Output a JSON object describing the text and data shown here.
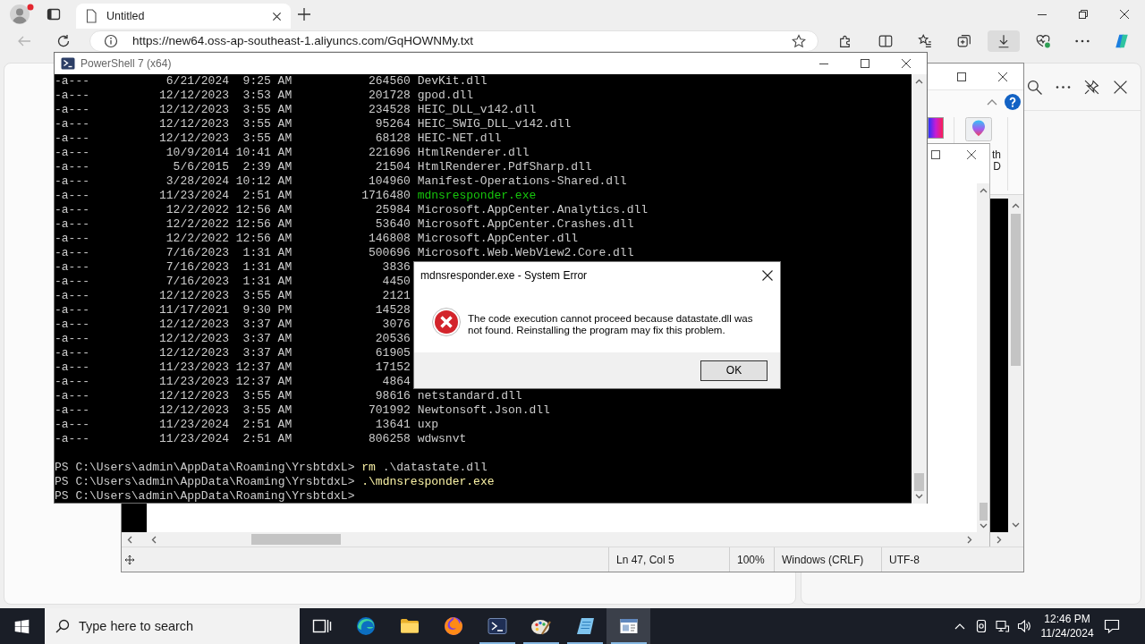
{
  "browser": {
    "tabs": [
      {
        "title": "Untitled",
        "selected": true
      }
    ],
    "back_button": {
      "disabled": true
    },
    "address_bar": {
      "url": "https://new64.oss-ap-southeast-1.aliyuncs.com/GqHOWNMy.txt"
    },
    "toolbar_buttons": [
      {
        "kind": "extensions",
        "selected": false
      },
      {
        "kind": "split",
        "selected": false
      },
      {
        "kind": "favorites",
        "selected": false
      },
      {
        "kind": "collections",
        "selected": false
      },
      {
        "kind": "downloads",
        "selected": true
      },
      {
        "kind": "essentials",
        "selected": false
      },
      {
        "kind": "more",
        "selected": false
      },
      {
        "kind": "copilot",
        "selected": false
      }
    ]
  },
  "background_window": {
    "ribbon_label": [
      "th",
      "D"
    ],
    "status_bar": {
      "position": "Ln 47, Col 5",
      "zoom": "100%",
      "line_ending": "Windows (CRLF)",
      "encoding": "UTF-8"
    }
  },
  "terminal": {
    "title": "PowerShell 7 (x64)",
    "files": [
      {
        "mode": "-a---",
        "date": "6/21/2024",
        "time": "9:25 AM",
        "length": "264560",
        "name": "DevKit.dll",
        "kind": "file"
      },
      {
        "mode": "-a---",
        "date": "12/12/2023",
        "time": "3:53 AM",
        "length": "201728",
        "name": "gpod.dll",
        "kind": "file"
      },
      {
        "mode": "-a---",
        "date": "12/12/2023",
        "time": "3:55 AM",
        "length": "234528",
        "name": "HEIC_DLL_v142.dll",
        "kind": "file"
      },
      {
        "mode": "-a---",
        "date": "12/12/2023",
        "time": "3:55 AM",
        "length": "95264",
        "name": "HEIC_SWIG_DLL_v142.dll",
        "kind": "file"
      },
      {
        "mode": "-a---",
        "date": "12/12/2023",
        "time": "3:55 AM",
        "length": "68128",
        "name": "HEIC-NET.dll",
        "kind": "file"
      },
      {
        "mode": "-a---",
        "date": "10/9/2014",
        "time": "10:41 AM",
        "length": "221696",
        "name": "HtmlRenderer.dll",
        "kind": "file"
      },
      {
        "mode": "-a---",
        "date": "5/6/2015",
        "time": "2:39 AM",
        "length": "21504",
        "name": "HtmlRenderer.PdfSharp.dll",
        "kind": "file"
      },
      {
        "mode": "-a---",
        "date": "3/28/2024",
        "time": "10:12 AM",
        "length": "104960",
        "name": "Manifest-Operations-Shared.dll",
        "kind": "file"
      },
      {
        "mode": "-a---",
        "date": "11/23/2024",
        "time": "2:51 AM",
        "length": "1716480",
        "name": "mdnsresponder.exe",
        "kind": "exe"
      },
      {
        "mode": "-a---",
        "date": "12/2/2022",
        "time": "12:56 AM",
        "length": "25984",
        "name": "Microsoft.AppCenter.Analytics.dll",
        "kind": "file"
      },
      {
        "mode": "-a---",
        "date": "12/2/2022",
        "time": "12:56 AM",
        "length": "53640",
        "name": "Microsoft.AppCenter.Crashes.dll",
        "kind": "file"
      },
      {
        "mode": "-a---",
        "date": "12/2/2022",
        "time": "12:56 AM",
        "length": "146808",
        "name": "Microsoft.AppCenter.dll",
        "kind": "file"
      },
      {
        "mode": "-a---",
        "date": "7/16/2023",
        "time": "1:31 AM",
        "length": "500696",
        "name": "Microsoft.Web.WebView2.Core.dll",
        "kind": "file"
      },
      {
        "mode": "-a---",
        "date": "7/16/2023",
        "time": "1:31 AM",
        "length": "3836"
      },
      {
        "mode": "-a---",
        "date": "7/16/2023",
        "time": "1:31 AM",
        "length": "4450"
      },
      {
        "mode": "-a---",
        "date": "12/12/2023",
        "time": "3:55 AM",
        "length": "2121"
      },
      {
        "mode": "-a---",
        "date": "11/17/2021",
        "time": "9:30 PM",
        "length": "14528"
      },
      {
        "mode": "-a---",
        "date": "12/12/2023",
        "time": "3:37 AM",
        "length": "3076"
      },
      {
        "mode": "-a---",
        "date": "12/12/2023",
        "time": "3:37 AM",
        "length": "20536"
      },
      {
        "mode": "-a---",
        "date": "12/12/2023",
        "time": "3:37 AM",
        "length": "61905"
      },
      {
        "mode": "-a---",
        "date": "11/23/2023",
        "time": "12:37 AM",
        "length": "17152"
      },
      {
        "mode": "-a---",
        "date": "11/23/2023",
        "time": "12:37 AM",
        "length": "4864"
      },
      {
        "mode": "-a---",
        "date": "12/12/2023",
        "time": "3:55 AM",
        "length": "98616",
        "name": "netstandard.dll",
        "kind": "file"
      },
      {
        "mode": "-a---",
        "date": "12/12/2023",
        "time": "3:55 AM",
        "length": "701992",
        "name": "Newtonsoft.Json.dll",
        "kind": "file"
      },
      {
        "mode": "-a---",
        "date": "11/23/2024",
        "time": "2:51 AM",
        "length": "13641",
        "name": "uxp",
        "kind": "file"
      },
      {
        "mode": "-a---",
        "date": "11/23/2024",
        "time": "2:51 AM",
        "length": "806258",
        "name": "wdwsnvt",
        "kind": "file"
      }
    ],
    "prompts": [
      {
        "prompt": "PS C:\\Users\\admin\\AppData\\Roaming\\YrsbtdxL>",
        "command": "rm",
        "argument": ".\\datastate.dll"
      },
      {
        "prompt": "PS C:\\Users\\admin\\AppData\\Roaming\\YrsbtdxL>",
        "command": ".\\mdnsresponder.exe"
      },
      {
        "prompt": "PS C:\\Users\\admin\\AppData\\Roaming\\YrsbtdxL>"
      }
    ]
  },
  "dialog": {
    "title": "mdnsresponder.exe - System Error",
    "message": "The code execution cannot proceed because datastate.dll was not found. Reinstalling the program may fix this problem.",
    "button": "OK"
  },
  "taskbar": {
    "search": {
      "placeholder": "Type here to search"
    },
    "apps": [
      {
        "kind": "taskview",
        "running": false,
        "selected": false
      },
      {
        "kind": "edge",
        "running": false,
        "selected": false
      },
      {
        "kind": "explorer",
        "running": false,
        "selected": false
      },
      {
        "kind": "firefox",
        "running": false,
        "selected": false
      },
      {
        "kind": "terminal",
        "running": true,
        "selected": false
      },
      {
        "kind": "paint",
        "running": true,
        "selected": false
      },
      {
        "kind": "notepad",
        "running": true,
        "selected": false
      },
      {
        "kind": "window",
        "running": true,
        "selected": true
      }
    ],
    "clock": {
      "time": "12:46 PM",
      "date": "11/24/2024"
    }
  }
}
